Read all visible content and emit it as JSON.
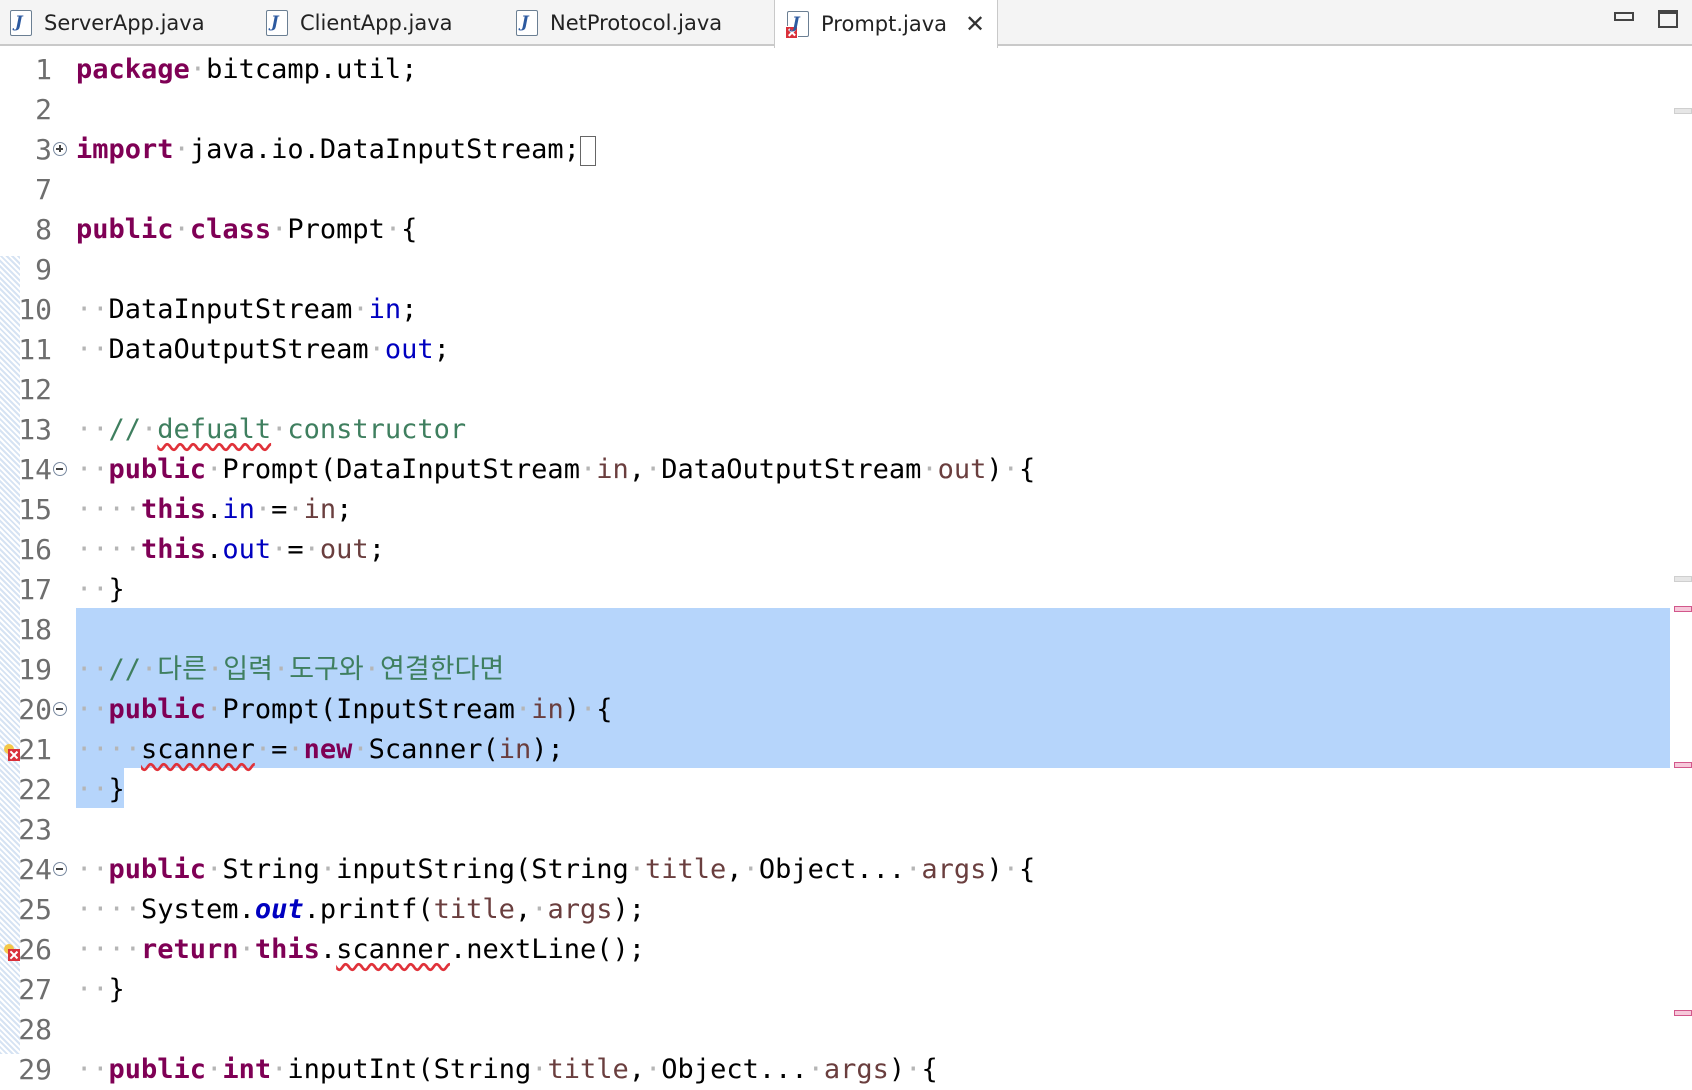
{
  "tabs": [
    {
      "label": "ServerApp.java",
      "active": false,
      "error": false
    },
    {
      "label": "ClientApp.java",
      "active": false,
      "error": false
    },
    {
      "label": "NetProtocol.java",
      "active": false,
      "error": false
    },
    {
      "label": "Prompt.java",
      "active": true,
      "error": true
    }
  ],
  "tab_close": "✕",
  "window_controls": [
    "minimize-icon",
    "maximize-icon"
  ],
  "colors": {
    "keyword": "#7f0055",
    "field": "#0000c0",
    "variable": "#6a3e3e",
    "comment": "#3f7f5f",
    "selection": "#b6d5fb",
    "error": "#e0323a"
  },
  "editor": {
    "lines": [
      {
        "num": "1",
        "tokens": [
          [
            "kw",
            "package"
          ],
          [
            "ws",
            "·"
          ],
          [
            "",
            "bitcamp.util;"
          ]
        ]
      },
      {
        "num": "2",
        "tokens": []
      },
      {
        "num": "3",
        "fold": "plus",
        "tokens": [
          [
            "kw",
            "import"
          ],
          [
            "ws",
            "·"
          ],
          [
            "",
            "java.io.DataInputStream;"
          ],
          [
            "box",
            ""
          ]
        ]
      },
      {
        "num": "7",
        "tokens": []
      },
      {
        "num": "8",
        "tokens": [
          [
            "kw",
            "public"
          ],
          [
            "ws",
            "·"
          ],
          [
            "kw",
            "class"
          ],
          [
            "ws",
            "·"
          ],
          [
            "",
            "Prompt"
          ],
          [
            "ws",
            "·"
          ],
          [
            "",
            "{"
          ]
        ]
      },
      {
        "num": "9",
        "tokens": []
      },
      {
        "num": "10",
        "tokens": [
          [
            "ws",
            "··"
          ],
          [
            "",
            "DataInputStream"
          ],
          [
            "ws",
            "·"
          ],
          [
            "fld",
            "in"
          ],
          [
            "",
            ";"
          ]
        ]
      },
      {
        "num": "11",
        "tokens": [
          [
            "ws",
            "··"
          ],
          [
            "",
            "DataOutputStream"
          ],
          [
            "ws",
            "·"
          ],
          [
            "fld",
            "out"
          ],
          [
            "",
            ";"
          ]
        ]
      },
      {
        "num": "12",
        "tokens": []
      },
      {
        "num": "13",
        "tokens": [
          [
            "ws",
            "··"
          ],
          [
            "cmt",
            "//"
          ],
          [
            "ws",
            "·"
          ],
          [
            "cmt err",
            "defualt"
          ],
          [
            "ws",
            "·"
          ],
          [
            "cmt",
            "constructor"
          ]
        ]
      },
      {
        "num": "14",
        "fold": "minus",
        "tokens": [
          [
            "ws",
            "··"
          ],
          [
            "kw",
            "public"
          ],
          [
            "ws",
            "·"
          ],
          [
            "",
            "Prompt(DataInputStream"
          ],
          [
            "ws",
            "·"
          ],
          [
            "var",
            "in"
          ],
          [
            "",
            ","
          ],
          [
            "ws",
            "·"
          ],
          [
            "",
            "DataOutputStream"
          ],
          [
            "ws",
            "·"
          ],
          [
            "var",
            "out"
          ],
          [
            "",
            ")"
          ],
          [
            "ws",
            "·"
          ],
          [
            "",
            "{"
          ]
        ]
      },
      {
        "num": "15",
        "tokens": [
          [
            "ws",
            "····"
          ],
          [
            "kw",
            "this"
          ],
          [
            "",
            "."
          ],
          [
            "fld",
            "in"
          ],
          [
            "ws",
            "·"
          ],
          [
            "",
            "="
          ],
          [
            "ws",
            "·"
          ],
          [
            "var",
            "in"
          ],
          [
            "",
            ";"
          ]
        ]
      },
      {
        "num": "16",
        "tokens": [
          [
            "ws",
            "····"
          ],
          [
            "kw",
            "this"
          ],
          [
            "",
            "."
          ],
          [
            "fld",
            "out"
          ],
          [
            "ws",
            "·"
          ],
          [
            "",
            "="
          ],
          [
            "ws",
            "·"
          ],
          [
            "var",
            "out"
          ],
          [
            "",
            ";"
          ]
        ]
      },
      {
        "num": "17",
        "tokens": [
          [
            "ws",
            "··"
          ],
          [
            "",
            "}"
          ]
        ]
      },
      {
        "num": "18",
        "tokens": []
      },
      {
        "num": "19",
        "tokens": [
          [
            "ws",
            "··"
          ],
          [
            "cmt",
            "//"
          ],
          [
            "ws",
            "·"
          ],
          [
            "cmt",
            "다른"
          ],
          [
            "ws",
            "·"
          ],
          [
            "cmt",
            "입력"
          ],
          [
            "ws",
            "·"
          ],
          [
            "cmt",
            "도구와"
          ],
          [
            "ws",
            "·"
          ],
          [
            "cmt",
            "연결한다면"
          ]
        ]
      },
      {
        "num": "20",
        "fold": "minus",
        "tokens": [
          [
            "ws",
            "··"
          ],
          [
            "kw",
            "public"
          ],
          [
            "ws",
            "·"
          ],
          [
            "",
            "Prompt(InputStream"
          ],
          [
            "ws",
            "·"
          ],
          [
            "var",
            "in"
          ],
          [
            "",
            ")"
          ],
          [
            "ws",
            "·"
          ],
          [
            "",
            "{"
          ]
        ]
      },
      {
        "num": "21",
        "error": true,
        "tokens": [
          [
            "ws",
            "····"
          ],
          [
            "err",
            "scanner"
          ],
          [
            "ws",
            "·"
          ],
          [
            "",
            "="
          ],
          [
            "ws",
            "·"
          ],
          [
            "kw",
            "new"
          ],
          [
            "ws",
            "·"
          ],
          [
            "",
            "Scanner("
          ],
          [
            "var",
            "in"
          ],
          [
            "",
            ");"
          ]
        ]
      },
      {
        "num": "22",
        "tokens": [
          [
            "ws",
            "··"
          ],
          [
            "",
            "}"
          ]
        ]
      },
      {
        "num": "23",
        "tokens": []
      },
      {
        "num": "24",
        "fold": "minus",
        "tokens": [
          [
            "ws",
            "··"
          ],
          [
            "kw",
            "public"
          ],
          [
            "ws",
            "·"
          ],
          [
            "",
            "String"
          ],
          [
            "ws",
            "·"
          ],
          [
            "",
            "inputString(String"
          ],
          [
            "ws",
            "·"
          ],
          [
            "var",
            "title"
          ],
          [
            "",
            ","
          ],
          [
            "ws",
            "·"
          ],
          [
            "",
            "Object..."
          ],
          [
            "ws",
            "·"
          ],
          [
            "var",
            "args"
          ],
          [
            "",
            ")"
          ],
          [
            "ws",
            "·"
          ],
          [
            "",
            "{"
          ]
        ]
      },
      {
        "num": "25",
        "tokens": [
          [
            "ws",
            "····"
          ],
          [
            "",
            "System."
          ],
          [
            "fldi",
            "out"
          ],
          [
            "",
            ".printf("
          ],
          [
            "var",
            "title"
          ],
          [
            "",
            ","
          ],
          [
            "ws",
            "·"
          ],
          [
            "var",
            "args"
          ],
          [
            "",
            ");"
          ]
        ]
      },
      {
        "num": "26",
        "error": true,
        "tokens": [
          [
            "ws",
            "····"
          ],
          [
            "kw",
            "return"
          ],
          [
            "ws",
            "·"
          ],
          [
            "kw",
            "this"
          ],
          [
            "",
            "."
          ],
          [
            "err",
            "scanner"
          ],
          [
            "",
            ".nextLine();"
          ]
        ]
      },
      {
        "num": "27",
        "tokens": [
          [
            "ws",
            "··"
          ],
          [
            "",
            "}"
          ]
        ]
      },
      {
        "num": "28",
        "tokens": []
      },
      {
        "num": "29",
        "tokens": [
          [
            "ws",
            "··"
          ],
          [
            "kw",
            "public"
          ],
          [
            "ws",
            "·"
          ],
          [
            "kw",
            "int"
          ],
          [
            "ws",
            "·"
          ],
          [
            "",
            "inputInt(String"
          ],
          [
            "ws",
            "·"
          ],
          [
            "var",
            "title"
          ],
          [
            "",
            ","
          ],
          [
            "ws",
            "·"
          ],
          [
            "",
            "Object..."
          ],
          [
            "ws",
            "·"
          ],
          [
            "var",
            "args"
          ],
          [
            "",
            ")"
          ],
          [
            "ws",
            "·"
          ],
          [
            "",
            "{"
          ]
        ]
      }
    ]
  }
}
